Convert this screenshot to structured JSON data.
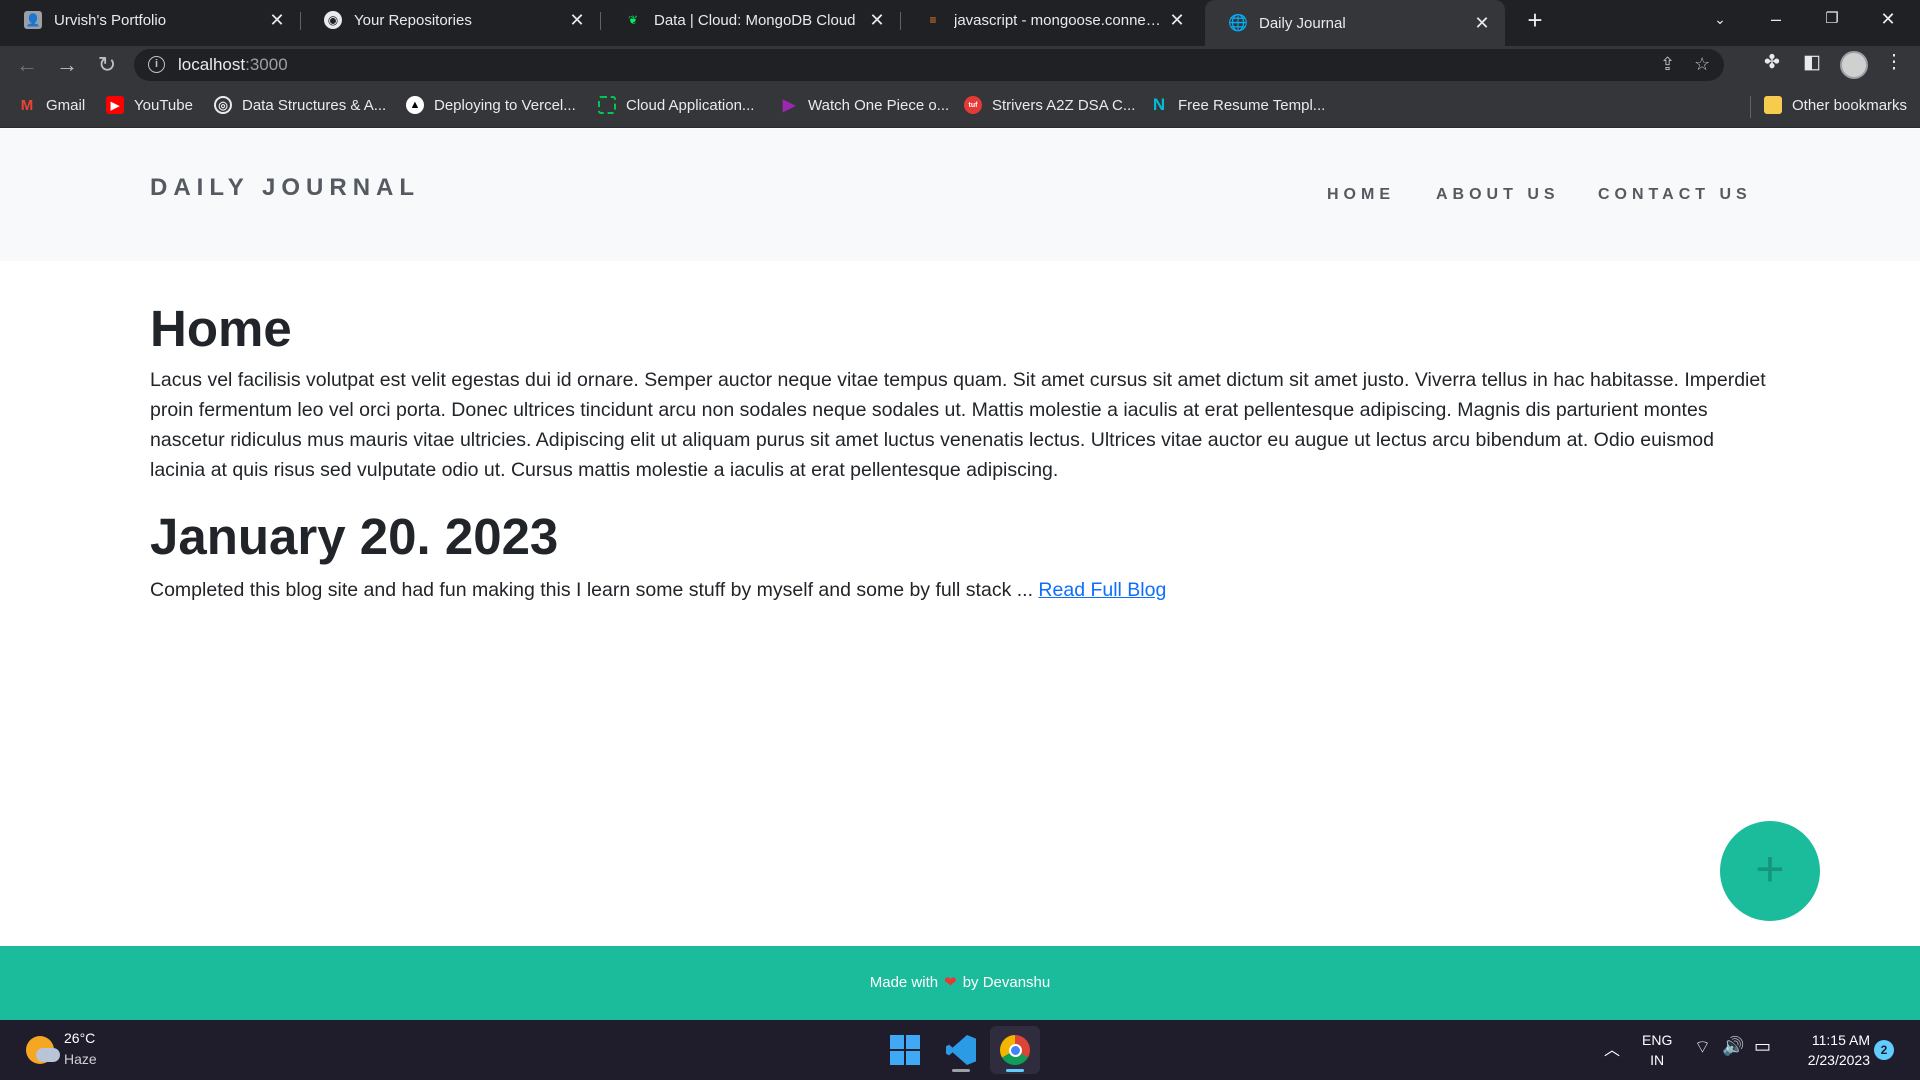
{
  "browser": {
    "tabs": [
      {
        "title": "Urvish's Portfolio",
        "icon": "portfolio-avatar-icon"
      },
      {
        "title": "Your Repositories",
        "icon": "github-icon"
      },
      {
        "title": "Data | Cloud: MongoDB Cloud",
        "icon": "mongodb-leaf-icon"
      },
      {
        "title": "javascript - mongoose.connect()...",
        "icon": "stackoverflow-icon"
      },
      {
        "title": "Daily Journal",
        "icon": "globe-icon"
      }
    ],
    "active_tab": 4,
    "address": {
      "host": "localhost",
      "port": ":3000"
    },
    "bookmarks": [
      {
        "label": "Gmail",
        "color": "#ea4335",
        "glyph": "M"
      },
      {
        "label": "YouTube",
        "color": "#ff0000",
        "glyph": "▶"
      },
      {
        "label": "Data Structures & A...",
        "color": "#ffffff",
        "glyph": "◎"
      },
      {
        "label": "Deploying to Vercel...",
        "color": "#ffffff",
        "glyph": "▲"
      },
      {
        "label": "Cloud Application...",
        "color": "#00c853",
        "glyph": "⬚"
      },
      {
        "label": "Watch One Piece o...",
        "color": "#8e24aa",
        "glyph": "▶"
      },
      {
        "label": "Strivers A2Z DSA C...",
        "color": "#e53935",
        "glyph": "tuf"
      },
      {
        "label": "Free Resume Templ...",
        "color": "#00bcd4",
        "glyph": "N"
      }
    ],
    "other_bookmarks": "Other bookmarks"
  },
  "site": {
    "brand": "DAILY JOURNAL",
    "nav": {
      "home": "HOME",
      "about": "ABOUT US",
      "contact": "CONTACT US"
    },
    "home_heading": "Home",
    "home_text": "Lacus vel facilisis volutpat est velit egestas dui id ornare. Semper auctor neque vitae tempus quam. Sit amet cursus sit amet dictum sit amet justo. Viverra tellus in hac habitasse. Imperdiet proin fermentum leo vel orci porta. Donec ultrices tincidunt arcu non sodales neque sodales ut. Mattis molestie a iaculis at erat pellentesque adipiscing. Magnis dis parturient montes nascetur ridiculus mus mauris vitae ultricies. Adipiscing elit ut aliquam purus sit amet luctus venenatis lectus. Ultrices vitae auctor eu augue ut lectus arcu bibendum at. Odio euismod lacinia at quis risus sed vulputate odio ut. Cursus mattis molestie a iaculis at erat pellentesque adipiscing.",
    "post": {
      "title": "January 20. 2023",
      "excerpt": "Completed this blog site and had fun making this I learn some stuff by myself and some by full stack ... ",
      "read_more": "Read Full Blog"
    },
    "fab_symbol": "+",
    "footer": {
      "before": "Made with",
      "heart": "❤",
      "after": "by Devanshu"
    },
    "colors": {
      "accent": "#1abc9c",
      "link": "#0d6efd",
      "nav_bg": "#f8f9fa"
    }
  },
  "taskbar": {
    "weather": {
      "temp": "26°C",
      "desc": "Haze"
    },
    "lang": {
      "line1": "ENG",
      "line2": "IN"
    },
    "clock": {
      "time": "11:15 AM",
      "date": "2/23/2023"
    },
    "notifications": "2"
  }
}
